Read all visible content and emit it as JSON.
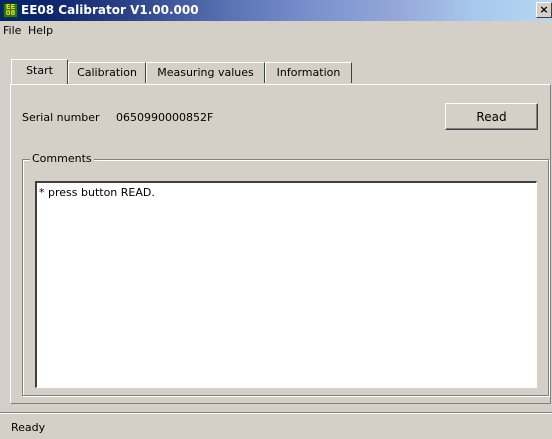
{
  "window": {
    "title": "EE08 Calibrator V1.00.000",
    "icon": "app-icon",
    "close_symbol": "×"
  },
  "menu": {
    "items": [
      "File",
      "Help"
    ]
  },
  "tabs": [
    {
      "label": "Start",
      "active": true
    },
    {
      "label": "Calibration",
      "active": false
    },
    {
      "label": "Measuring values",
      "active": false
    },
    {
      "label": "Information",
      "active": false
    }
  ],
  "start": {
    "serial_label": "Serial number",
    "serial_value": "0650990000852F",
    "read_button": "Read",
    "comments_label": "Comments",
    "comments_text": "* press button READ."
  },
  "status": {
    "text": "Ready"
  },
  "colors": {
    "face": "#d4d0c8",
    "titlebar_dark": "#0a246a",
    "titlebar_light": "#b7d7f3"
  }
}
